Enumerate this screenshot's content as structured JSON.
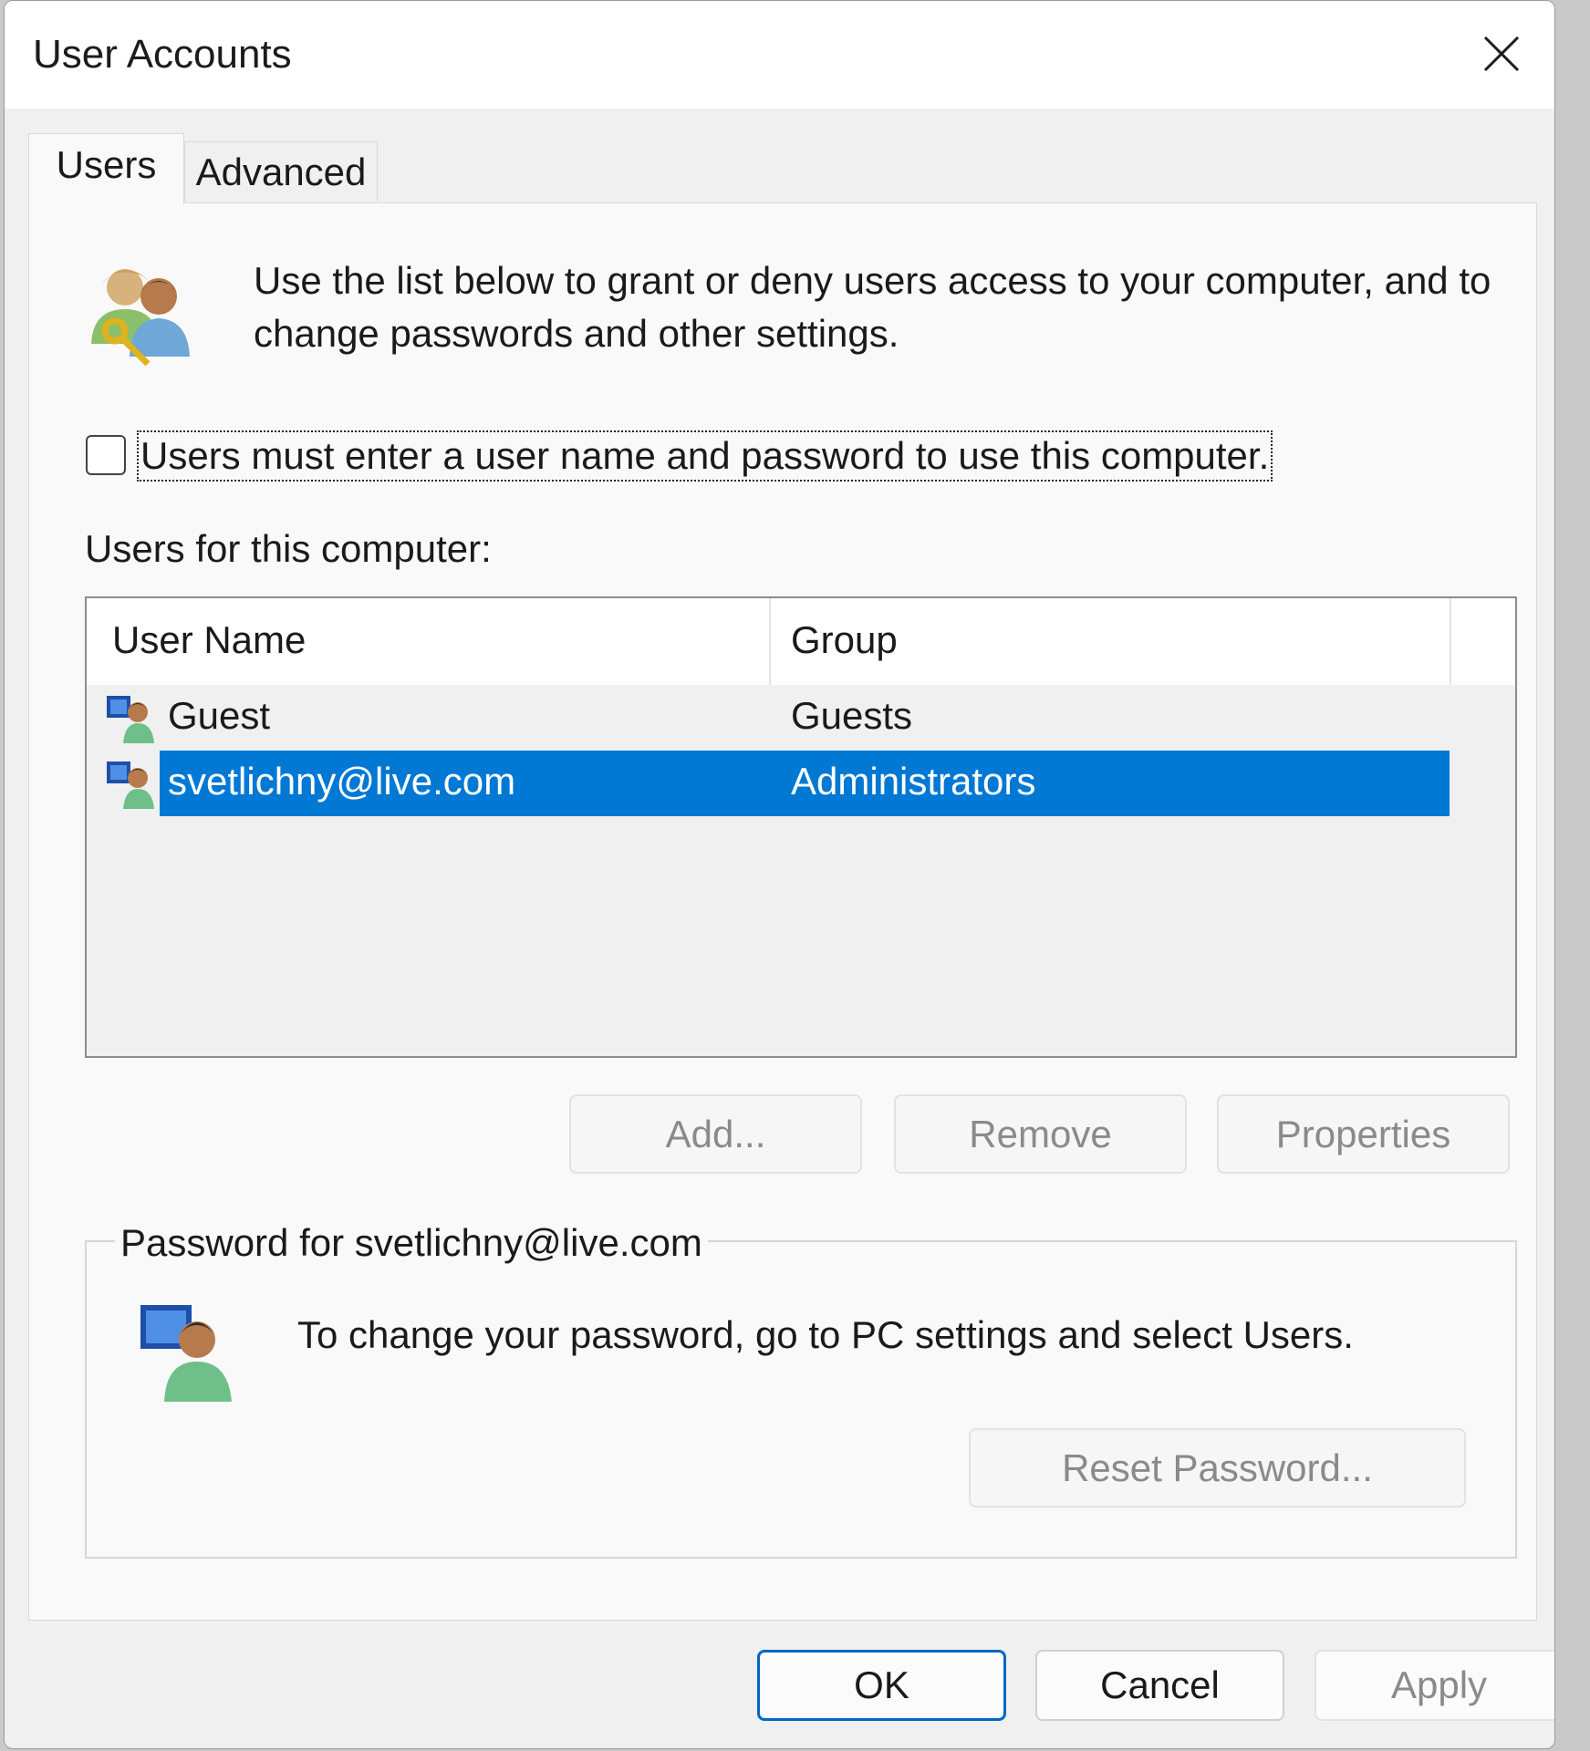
{
  "window": {
    "title": "User Accounts"
  },
  "tabs": [
    {
      "label": "Users",
      "active": true
    },
    {
      "label": "Advanced",
      "active": false
    }
  ],
  "users_tab": {
    "intro_text": "Use the list below to grant or deny users access to your computer, and to change passwords and other settings.",
    "require_login_checkbox": {
      "label": "Users must enter a user name and password to use this computer.",
      "checked": false
    },
    "users_list_label": "Users for this computer:",
    "columns": [
      "User Name",
      "Group"
    ],
    "rows": [
      {
        "user_name": "Guest",
        "group": "Guests",
        "selected": false
      },
      {
        "user_name": "svetlichny@live.com",
        "group": "Administrators",
        "selected": true
      }
    ],
    "buttons": {
      "add": "Add...",
      "remove": "Remove",
      "properties": "Properties"
    },
    "password_group": {
      "legend": "Password for svetlichny@live.com",
      "message": "To change your password, go to PC settings and select Users.",
      "reset_button": "Reset Password..."
    }
  },
  "footer": {
    "ok": "OK",
    "cancel": "Cancel",
    "apply": "Apply"
  },
  "colors": {
    "selection": "#0078d4",
    "dialog_bg": "#f0f0f0",
    "panel_bg": "#f9f9f9",
    "ok_border": "#0067c0"
  },
  "icons": [
    "close-icon",
    "users-key-icon",
    "user-computer-icon"
  ]
}
